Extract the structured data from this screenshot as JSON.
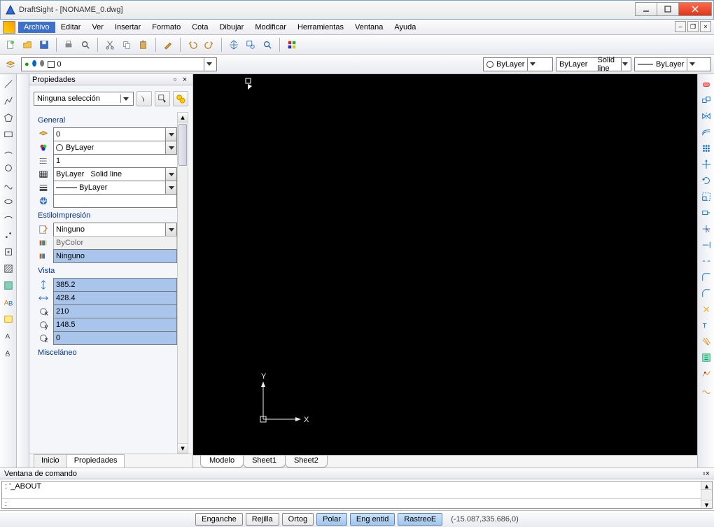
{
  "title": "DraftSight - [NONAME_0.dwg]",
  "menu": {
    "file": "Archivo",
    "edit": "Editar",
    "view": "Ver",
    "insert": "Insertar",
    "format": "Formato",
    "dim": "Cota",
    "draw": "Dibujar",
    "modify": "Modificar",
    "tools": "Herramientas",
    "window": "Ventana",
    "help": "Ayuda"
  },
  "layer_toolbar": {
    "current_layer": "0",
    "color": "ByLayer",
    "lstyle": "ByLayer",
    "lstyle2": "Solid line",
    "lweight": "ByLayer"
  },
  "properties_panel": {
    "title": "Propiedades",
    "selection": "Ninguna selección",
    "groups": {
      "general": "General",
      "plotstyle": "EstiloImpresión",
      "view": "Vista",
      "misc": "Misceláneo"
    },
    "general": {
      "layer": "0",
      "color": "ByLayer",
      "scale": "1",
      "linestyle_a": "ByLayer",
      "linestyle_b": "Solid line",
      "lineweight": "ByLayer",
      "hyperlink": ""
    },
    "plotstyle": {
      "style": "Ninguno",
      "style_table": "ByColor",
      "attached": "Ninguno"
    },
    "view": {
      "v1": "385.2",
      "v2": "428.4",
      "v3": "210",
      "v4": "148.5",
      "v5": "0"
    }
  },
  "prop_tabs": {
    "start": "Inicio",
    "props": "Propiedades"
  },
  "model_tabs": {
    "model": "Modelo",
    "sheet1": "Sheet1",
    "sheet2": "Sheet2"
  },
  "command_panel": {
    "title": "Ventana de comando",
    "line": ": '_ABOUT",
    "prompt": ":"
  },
  "status": {
    "snap": "Enganche",
    "grid": "Rejilla",
    "ortho": "Ortog",
    "polar": "Polar",
    "esnap": "Eng entid",
    "etrack": "RastreoE",
    "coords": "(-15.087,335.686,0)"
  },
  "ucs": {
    "x": "X",
    "y": "Y"
  }
}
